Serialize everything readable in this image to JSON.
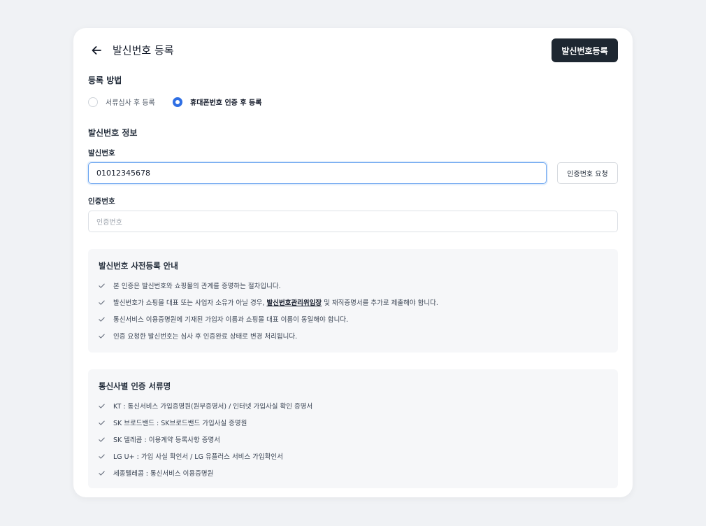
{
  "header": {
    "title": "발신번호 등록",
    "submit_label": "발신번호등록"
  },
  "method": {
    "title": "등록 방법",
    "options": [
      {
        "label": "서류심사 후 등록",
        "selected": false
      },
      {
        "label": "휴대폰번호 인증 후 등록",
        "selected": true
      }
    ]
  },
  "info_section": {
    "title": "발신번호 정보",
    "phone_label": "발신번호",
    "phone_value": "01012345678",
    "request_label": "인증번호 요청",
    "code_label": "인증번호",
    "code_placeholder": "인증번호"
  },
  "notice": {
    "title": "발신번호 사전등록 안내",
    "items": [
      {
        "text": "본 인증은 발신번호와 쇼핑몰의 관계를 증명하는 절차입니다."
      },
      {
        "pre": "발신번호가 쇼핑몰 대표 또는 사업자 소유가 아닐 경우,",
        "link": "발신번호관리위임장",
        "post": "및 재직증명서를 추가로 제출해야 합니다."
      },
      {
        "text": "통신서비스 이용증명원에 기재된 가입자 이름과 쇼핑몰 대표 이름이 동일해야 합니다."
      },
      {
        "text": "인증 요청한 발신번호는 심사 후 인증완료 상태로 변경 처리됩니다."
      }
    ]
  },
  "carrier_docs": {
    "title": "통신사별 인증 서류명",
    "items": [
      "KT : 통신서비스 가입증명원(원부증명서) / 인터넷 가입사실 확인 증명서",
      "SK 브로드밴드 : SK브로드밴드 가입사실 증명원",
      "SK 텔레콤 : 이용계약 등록사항 증명서",
      "LG U+ : 가입 사실 확인서 / LG 유플러스 서비스 가입확인서",
      "세종텔레콤 : 통신서비스 이용증명원"
    ]
  },
  "icons": {
    "back": "arrow-left-icon",
    "check": "check-icon"
  },
  "colors": {
    "primary_button": "#1e2731",
    "radio_selected": "#2f6fe4",
    "input_focus": "#6aa4f0"
  }
}
